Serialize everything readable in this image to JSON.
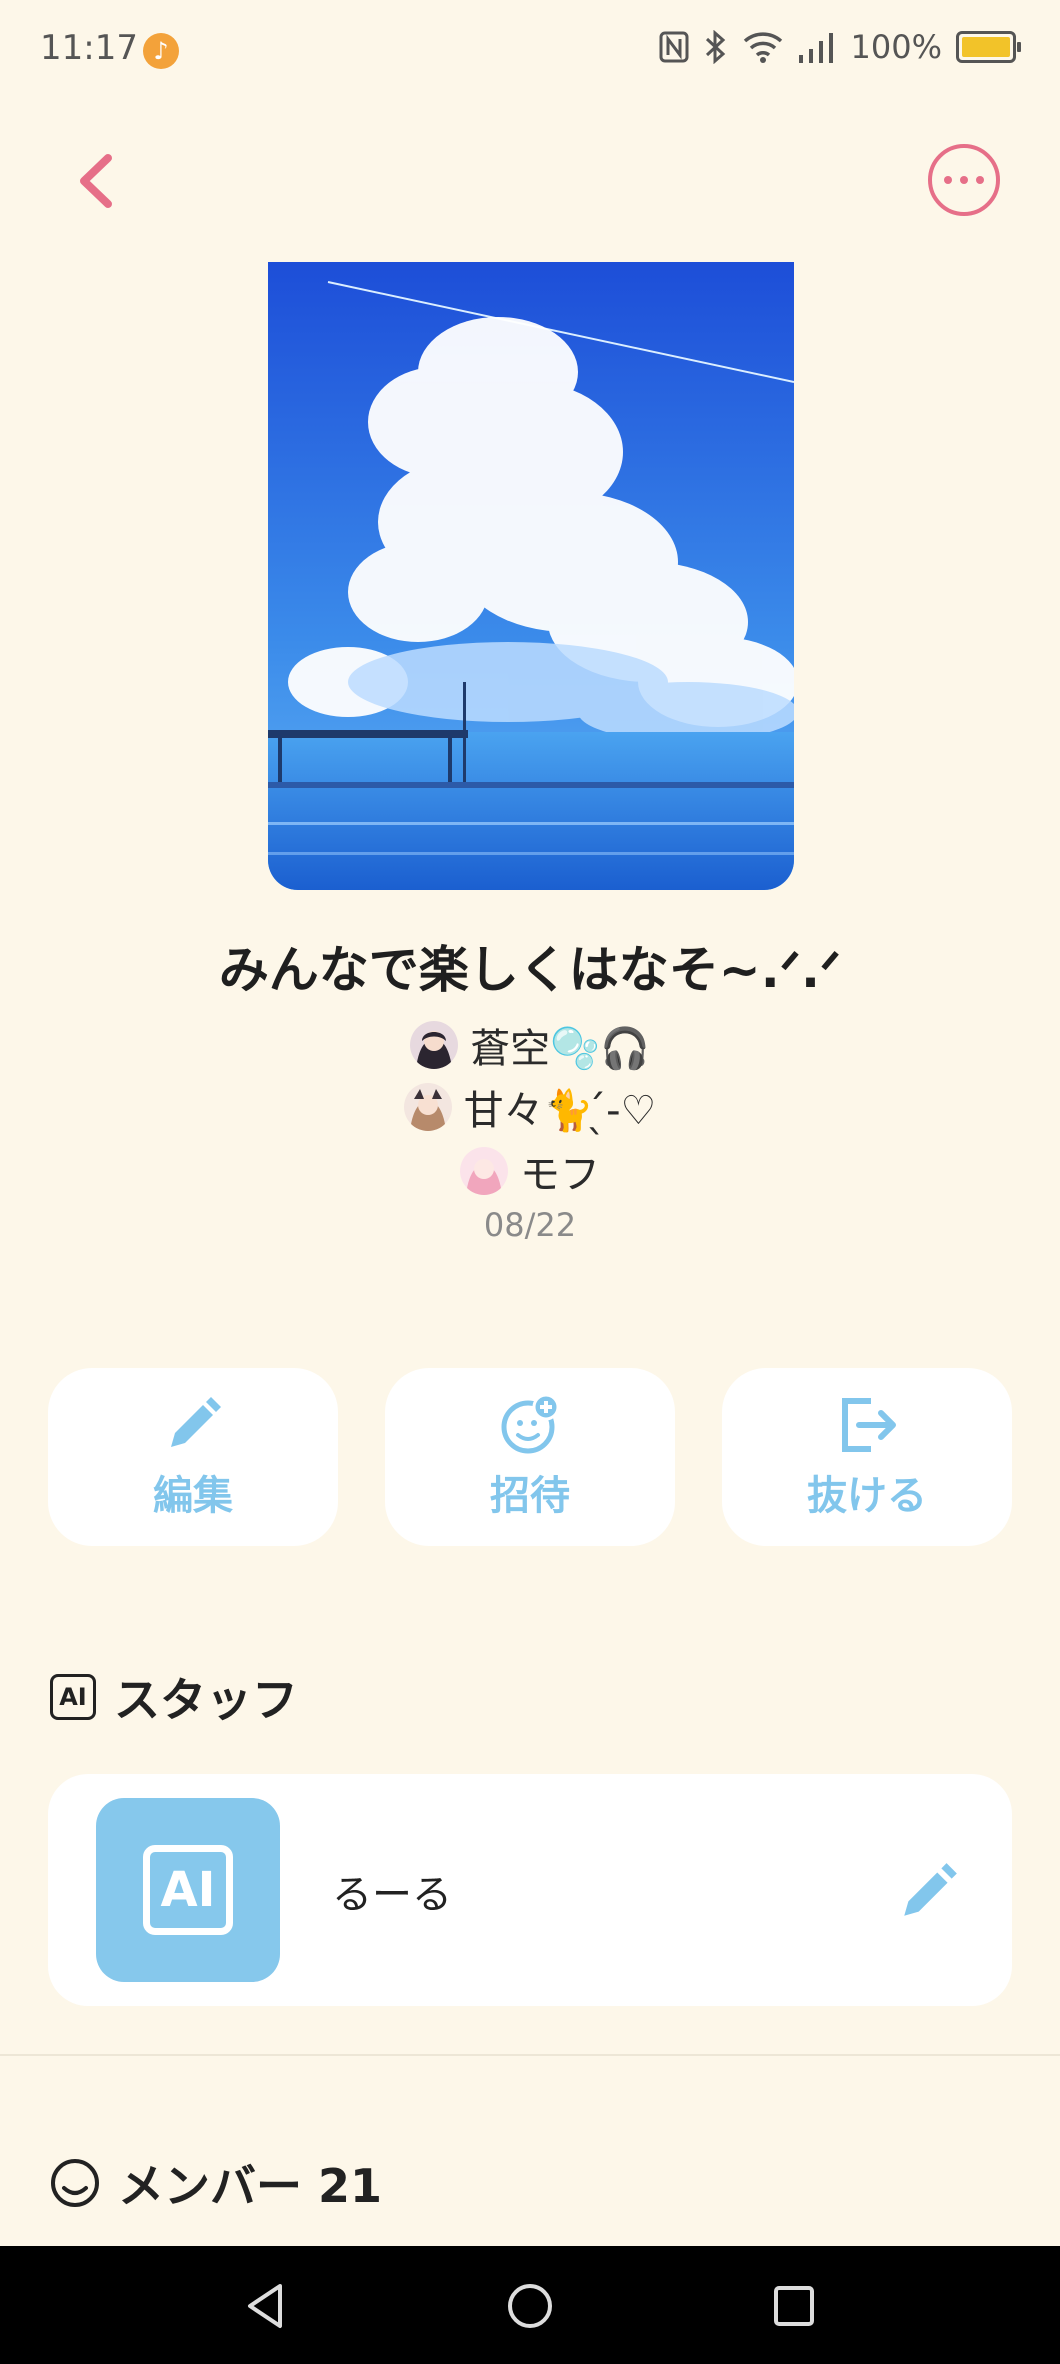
{
  "status_bar": {
    "time": "11:17",
    "battery": "100%",
    "icons": [
      "music-icon",
      "nfc-icon",
      "bluetooth-icon",
      "wifi-icon",
      "signal-icon",
      "battery-charging-icon"
    ]
  },
  "header": {
    "back_icon": "chevron-left-icon",
    "more_icon": "more-dots-icon"
  },
  "chat": {
    "title": "みんなで楽しくはなそ~.ᐟ.ᐟ",
    "members_preview": [
      {
        "name": "蒼空🫧🎧"
      },
      {
        "name": "甘々🐈 ̖́-♡"
      },
      {
        "name": "モフ"
      }
    ],
    "date": "08/22"
  },
  "actions": [
    {
      "label": "編集",
      "icon": "pencil-icon"
    },
    {
      "label": "招待",
      "icon": "invite-smile-icon"
    },
    {
      "label": "抜ける",
      "icon": "exit-icon"
    }
  ],
  "staff": {
    "heading": "スタッフ",
    "badge": "AI",
    "items": [
      {
        "name": "るーる",
        "tile_text": "AI"
      }
    ]
  },
  "members": {
    "heading": "メンバー 21"
  },
  "colors": {
    "background": "#fdf7e9",
    "accent_pink": "#e66f88",
    "accent_blue": "#82c6ec"
  }
}
